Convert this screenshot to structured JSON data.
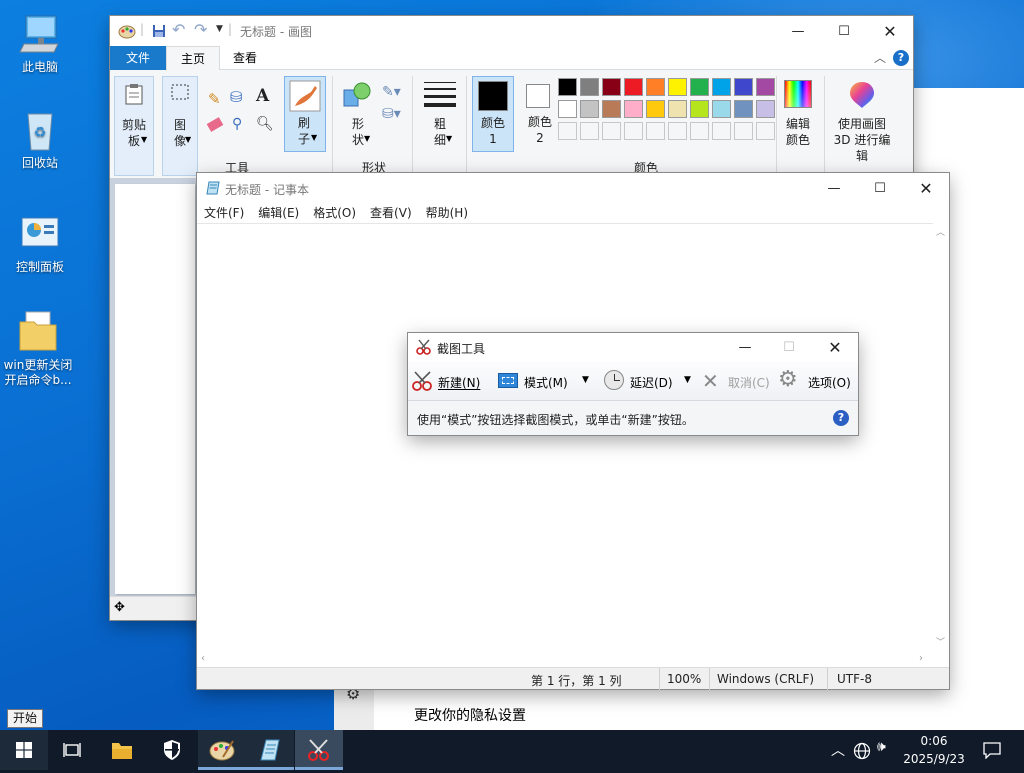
{
  "desktop": {
    "icons": [
      {
        "label": "此电脑",
        "icon": "computer-icon"
      },
      {
        "label": "回收站",
        "icon": "recycle-bin-icon"
      },
      {
        "label": "控制面板",
        "icon": "control-panel-icon"
      },
      {
        "label": "win更新关闭开启命令b...",
        "icon": "folder-icon"
      }
    ]
  },
  "paint": {
    "title": "无标题 - 画图",
    "tabs": [
      "文件",
      "主页",
      "查看"
    ],
    "groups": {
      "clipboard": "剪贴板",
      "image": "图像",
      "tools": "工具",
      "brush": "刷子",
      "shapes": "形状",
      "shapes_btn": "形状",
      "size": "粗细",
      "color1": "颜色 1",
      "color2": "颜色 2",
      "colors": "颜色",
      "edit_colors": "编辑颜色",
      "paint3d": "使用画图 3D 进行编辑"
    },
    "swatches_row1": [
      "#000000",
      "#7f7f7f",
      "#880015",
      "#ed1c24",
      "#ff7f27",
      "#fff200",
      "#22b14c",
      "#00a2e8",
      "#3f48cc",
      "#a349a4"
    ],
    "swatches_row2": [
      "#ffffff",
      "#c3c3c3",
      "#b97a57",
      "#ffaec9",
      "#ffc90e",
      "#efe4b0",
      "#b5e61d",
      "#99d9ea",
      "#7092be",
      "#c8bfe7"
    ]
  },
  "settings": {
    "privacy_text": "更改你的隐私设置"
  },
  "notepad": {
    "title": "无标题 - 记事本",
    "menu": [
      "文件(F)",
      "编辑(E)",
      "格式(O)",
      "查看(V)",
      "帮助(H)"
    ],
    "status": {
      "pos": "第 1 行，第 1 列",
      "zoom": "100%",
      "eol": "Windows (CRLF)",
      "enc": "UTF-8"
    }
  },
  "snip": {
    "title": "截图工具",
    "new": "新建(N)",
    "mode": "模式(M)",
    "delay": "延迟(D)",
    "cancel": "取消(C)",
    "options": "选项(O)",
    "hint": "使用“模式”按钮选择截图模式，或单击“新建”按钮。"
  },
  "taskbar": {
    "start_tooltip": "开始",
    "time": "0:06",
    "date": "2025/9/23"
  }
}
